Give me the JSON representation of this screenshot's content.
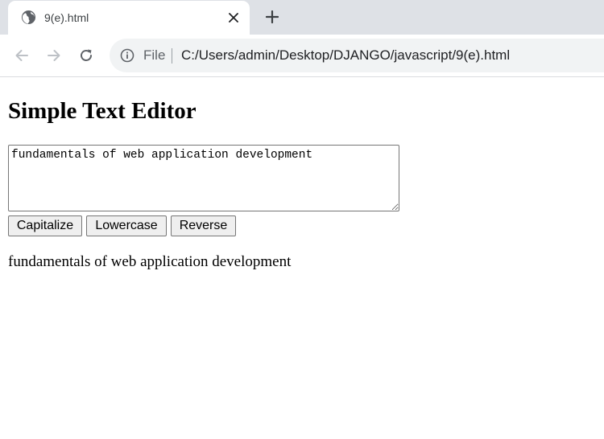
{
  "browser": {
    "tab": {
      "title": "9(e).html",
      "favicon_icon": "globe-icon",
      "close_icon": "close-icon"
    },
    "new_tab_icon": "plus-icon",
    "nav": {
      "back_icon": "arrow-left-icon",
      "forward_icon": "arrow-right-icon",
      "reload_icon": "reload-icon"
    },
    "address_bar": {
      "info_icon": "info-icon",
      "scheme": "File",
      "url": "C:/Users/admin/Desktop/DJANGO/javascript/9(e).html"
    }
  },
  "page": {
    "title": "Simple Text Editor",
    "editor": {
      "value": "fundamentals of web application development"
    },
    "buttons": {
      "capitalize": "Capitalize",
      "lowercase": "Lowercase",
      "reverse": "Reverse"
    },
    "output": "fundamentals of web application development"
  },
  "colors": {
    "tabstrip_bg": "#dee1e6",
    "omnibox_bg": "#f1f3f4",
    "button_bg": "#efefef",
    "icon_gray": "#5f6368"
  }
}
